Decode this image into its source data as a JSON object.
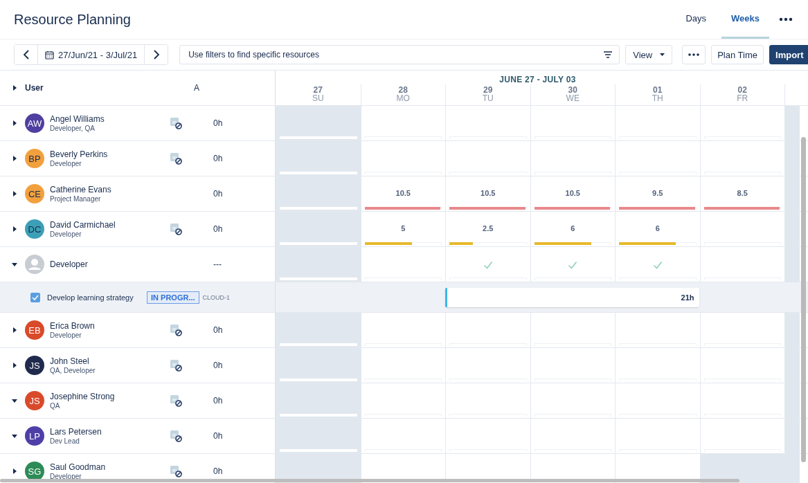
{
  "title": "Resource Planning",
  "tabs": [
    {
      "label": "Days",
      "selected": false
    },
    {
      "label": "Weeks",
      "selected": true
    }
  ],
  "toolbar": {
    "date_range": "27/Jun/21 - 3/Jul/21",
    "filter": {
      "placeholder": "Use filters to find specific resources"
    },
    "view": "View",
    "plan_time": "Plan Time",
    "import": "Import"
  },
  "table": {
    "columns": {
      "user": "User",
      "column_2": "A"
    },
    "period": "JUNE 27 - JULY 03",
    "days": [
      {
        "day": "27",
        "weekday": "SU",
        "weekend": true
      },
      {
        "day": "28",
        "weekday": "MO",
        "weekend": false
      },
      {
        "day": "29",
        "weekday": "TU",
        "weekend": false
      },
      {
        "day": "30",
        "weekday": "WE",
        "weekend": false
      },
      {
        "day": "01",
        "weekday": "TH",
        "weekend": false
      },
      {
        "day": "02",
        "weekday": "FR",
        "weekend": false
      },
      {
        "weekend": true
      }
    ],
    "rows": [
      {
        "kind": "user",
        "initials": "AW",
        "name": "Angel Williams",
        "role": "Developer, QA",
        "color": "#4f3fa0",
        "expanded": false,
        "blocked": true,
        "hours": "0h"
      },
      {
        "kind": "user",
        "initials": "BP",
        "name": "Beverly Perkins",
        "role": "Developer",
        "color": "#f2a03d",
        "expanded": false,
        "blocked": true,
        "hours": "0h"
      },
      {
        "kind": "user",
        "initials": "CE",
        "name": "Catherine Evans",
        "role": "Project Manager",
        "color": "#f2a03d",
        "expanded": false,
        "blocked": false,
        "hours": "0h",
        "cells": [
          {
            "kind": "empty"
          },
          {
            "kind": "load",
            "value": "10.5",
            "level": 1,
            "color": "#e8898c"
          },
          {
            "kind": "load",
            "value": "10.5",
            "level": 1,
            "color": "#e8898c"
          },
          {
            "kind": "load",
            "value": "10.5",
            "level": 1,
            "color": "#e8898c"
          },
          {
            "kind": "load",
            "value": "9.5",
            "level": 1,
            "color": "#e8898c"
          },
          {
            "kind": "load",
            "value": "8.5",
            "level": 1,
            "color": "#e8898c"
          }
        ]
      },
      {
        "kind": "user",
        "initials": "DC",
        "name": "David Carmichael",
        "role": "Developer",
        "color": "#3d9fb5",
        "expanded": false,
        "blocked": true,
        "hours": "0h",
        "cells": [
          {
            "kind": "empty"
          },
          {
            "kind": "load",
            "value": "5",
            "level": 0.63,
            "color": "#e8b92c"
          },
          {
            "kind": "load",
            "value": "2.5",
            "level": 0.31,
            "color": "#e8b92c"
          },
          {
            "kind": "load",
            "value": "6",
            "level": 0.75,
            "color": "#e8b92c"
          },
          {
            "kind": "load",
            "value": "6",
            "level": 0.75,
            "color": "#e8b92c"
          },
          {
            "kind": "empty"
          }
        ]
      },
      {
        "kind": "role",
        "name": "Developer",
        "expanded": true,
        "hours": "---",
        "cells": [
          {
            "kind": "empty"
          },
          {
            "kind": "empty"
          },
          {
            "kind": "check"
          },
          {
            "kind": "check"
          },
          {
            "kind": "check"
          },
          {
            "kind": "empty"
          }
        ]
      },
      {
        "kind": "task",
        "checked": true,
        "name": "Develop learning strategy",
        "status": "IN PROGR...",
        "key": "CLOUD-1",
        "cells": [
          {
            "kind": "empty"
          },
          {
            "kind": "empty"
          },
          {
            "kind": "bar"
          },
          {
            "kind": "bar"
          },
          {
            "kind": "bar"
          },
          {
            "kind": "empty"
          }
        ],
        "bar_label": "21h"
      },
      {
        "kind": "user",
        "initials": "EB",
        "name": "Erica Brown",
        "role": "Developer",
        "color": "#d94a2b",
        "expanded": false,
        "blocked": true,
        "hours": "0h"
      },
      {
        "kind": "user",
        "initials": "JS",
        "name": "John Steel",
        "role": "QA, Developer",
        "color": "#1f2a4d",
        "expanded": false,
        "blocked": true,
        "hours": "0h"
      },
      {
        "kind": "user",
        "initials": "JS",
        "name": "Josephine Strong",
        "role": "QA",
        "color": "#d94a2b",
        "expanded": true,
        "blocked": true,
        "hours": "0h"
      },
      {
        "kind": "user",
        "initials": "LP",
        "name": "Lars Petersen",
        "role": "Dev Lead",
        "color": "#4e3fa8",
        "expanded": true,
        "blocked": true,
        "hours": "0h"
      },
      {
        "kind": "user",
        "initials": "SG",
        "name": "Saul Goodman",
        "role": "Developer",
        "color": "#2e8b57",
        "expanded": false,
        "blocked": true,
        "hours": "0h",
        "cells": [
          {
            "kind": "empty"
          },
          {
            "kind": "empty"
          },
          {
            "kind": "empty"
          },
          {
            "kind": "empty"
          },
          {
            "kind": "empty"
          },
          {
            "kind": "unavailable"
          }
        ]
      }
    ]
  }
}
